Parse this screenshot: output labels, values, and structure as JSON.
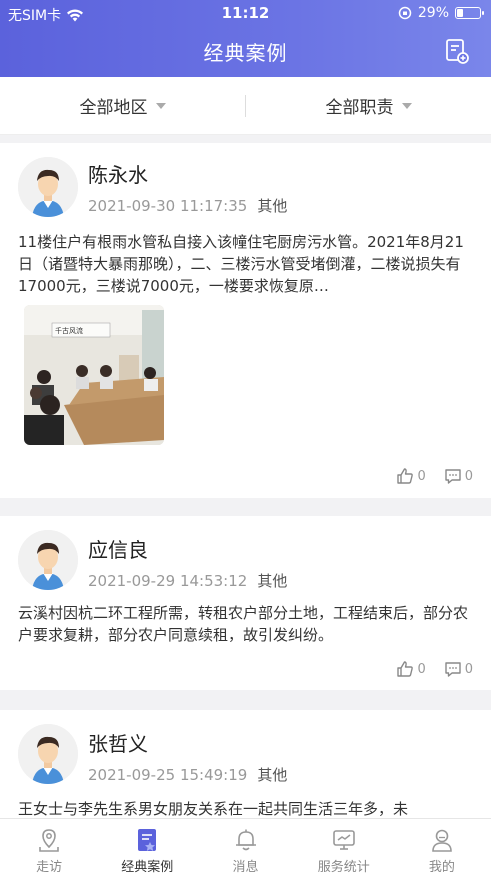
{
  "status_bar": {
    "carrier": "无SIM卡",
    "time": "11:12",
    "battery": "29%",
    "battery_level": 0.29
  },
  "nav": {
    "title": "经典案例",
    "action_icon": "add-document-icon"
  },
  "filters": [
    {
      "label": "全部地区"
    },
    {
      "label": "全部职责"
    }
  ],
  "cases": [
    {
      "name": "陈永水",
      "datetime": "2021-09-30 11:17:35",
      "category": "其他",
      "text": "11楼住户有根雨水管私自接入该幢住宅厨房污水管。2021年8月21日（诸暨特大暴雨那晚），二、三楼污水管受堵倒灌，二楼说损失有17000元，三楼说7000元，一楼要求恢复原…",
      "likes": "0",
      "comments": "0"
    },
    {
      "name": "应信良",
      "datetime": "2021-09-29 14:53:12",
      "category": "其他",
      "text": "云溪村因杭二环工程所需，转租农户部分土地，工程结束后，部分农户要求复耕，部分农户同意续租，故引发纠纷。",
      "likes": "0",
      "comments": "0"
    },
    {
      "name": "张哲义",
      "datetime": "2021-09-25 15:49:19",
      "category": "其他",
      "text": "王女士与李先生系男女朋友关系在一起共同生活三年多，未"
    }
  ],
  "tabs": [
    {
      "label": "走访",
      "icon": "map-pin-icon"
    },
    {
      "label": "经典案例",
      "icon": "document-icon",
      "active": true
    },
    {
      "label": "消息",
      "icon": "bell-icon"
    },
    {
      "label": "服务统计",
      "icon": "monitor-icon"
    },
    {
      "label": "我的",
      "icon": "user-icon"
    }
  ],
  "colors": {
    "header_start": "#5b62dc",
    "header_end": "#7a86ea",
    "accent": "#5b62dc"
  }
}
